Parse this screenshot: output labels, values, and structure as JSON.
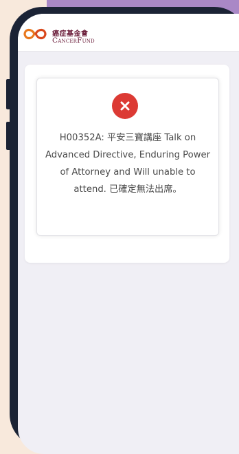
{
  "brand": {
    "name_zh": "癌症基金會",
    "name_en": "CancerFund",
    "logo_color": "#e8781e"
  },
  "dialog": {
    "status": "error",
    "status_icon": "close-icon",
    "status_color": "#dc3a34",
    "message": "H00352A: 平安三寶講座 Talk on Advanced Directive, Enduring Power of Attorney and Will unable to attend. 已確定無法出席。"
  }
}
